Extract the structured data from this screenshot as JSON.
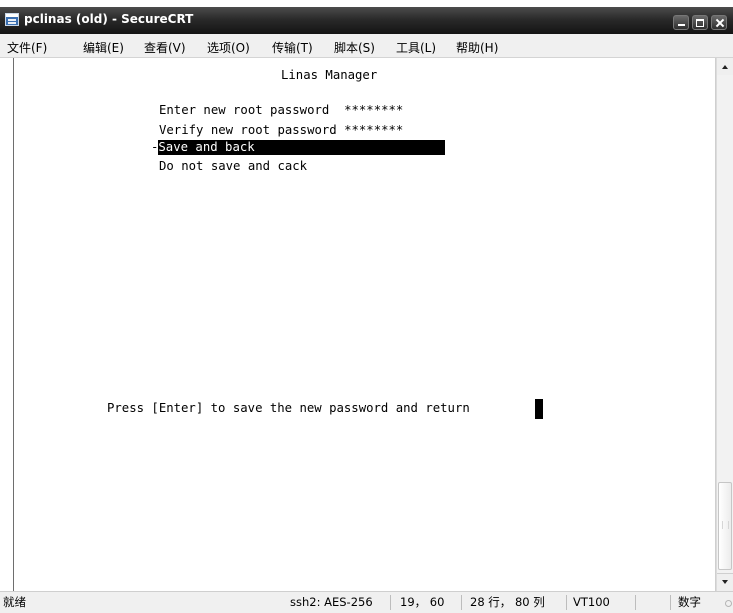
{
  "window": {
    "title": "pclinas (old) - SecureCRT"
  },
  "menu": [
    "文件(F)",
    "编辑(E)",
    "查看(V)",
    "选项(O)",
    "传输(T)",
    "脚本(S)",
    "工具(L)",
    "帮助(H)"
  ],
  "terminal": {
    "header": "Linas Manager",
    "lines": [
      "Enter new root password  ********",
      "Verify new root password ********"
    ],
    "selected_marker": "-",
    "selected": "Save and back",
    "option_2": "Do not save and cack",
    "prompt": "Press [Enter] to save the new password and return"
  },
  "statusbar": {
    "ready": "就绪",
    "protocol": "ssh2: AES-256",
    "cursor_pos": "19， 60",
    "size": "28 行， 80 列",
    "emulation": "VT100",
    "numlock": "数字"
  }
}
